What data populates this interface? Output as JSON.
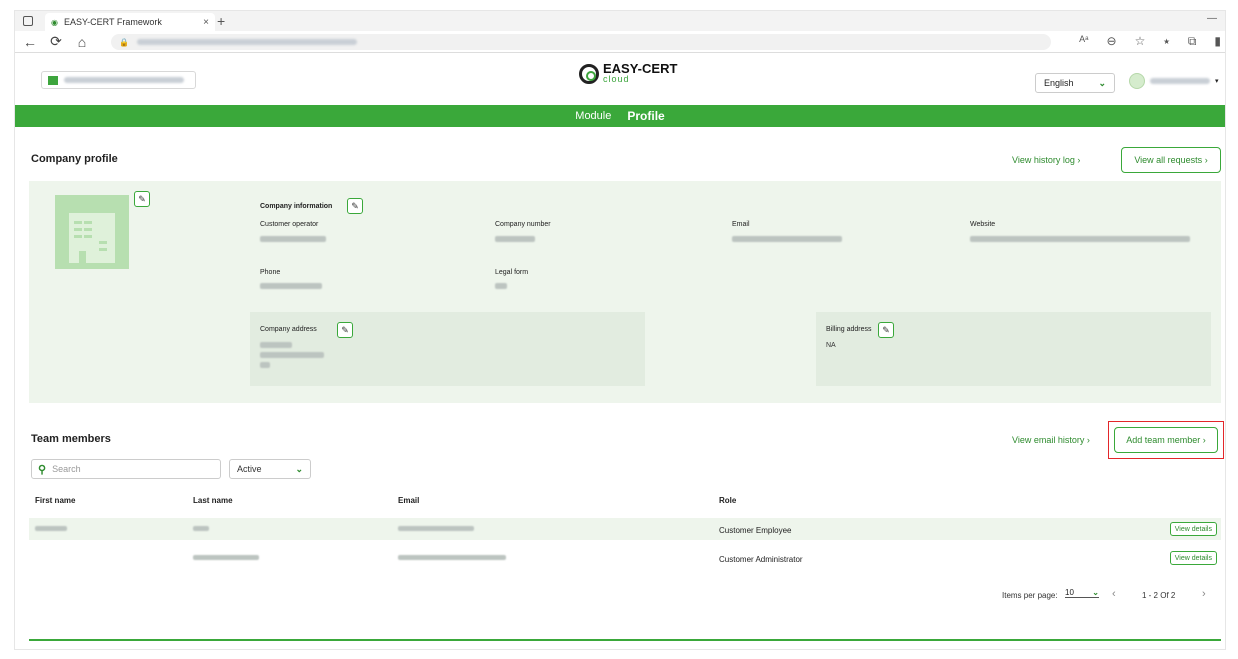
{
  "browser": {
    "tab_title": "EASY-CERT Framework",
    "close_glyph": "×",
    "new_tab_glyph": "+",
    "minimize_glyph": "—",
    "nav_glyphs": [
      "←",
      "⟳",
      "⌂",
      "🔒"
    ],
    "right_glyphs": [
      "Aᵃ",
      "⊖",
      "☆",
      "⭑",
      "⧉",
      "▮"
    ]
  },
  "header": {
    "logo_main": "EASY-CERT",
    "logo_sub": "cloud",
    "language": "English"
  },
  "nav": {
    "module": "Module",
    "profile": "Profile"
  },
  "company": {
    "title": "Company profile",
    "view_history": "View history log",
    "view_requests": "View all requests",
    "info_label": "Company information",
    "customer_operator_label": "Customer operator",
    "company_number_label": "Company number",
    "email_label": "Email",
    "website_label": "Website",
    "phone_label": "Phone",
    "legal_form_label": "Legal form",
    "company_address_label": "Company address",
    "billing_address_label": "Billing address",
    "billing_address_value": "NA"
  },
  "team": {
    "title": "Team members",
    "view_email_history": "View email history",
    "add_member": "Add team member",
    "search_placeholder": "Search",
    "status_filter": "Active",
    "columns": {
      "first_name": "First name",
      "last_name": "Last name",
      "email": "Email",
      "role": "Role"
    },
    "rows": [
      {
        "role": "Customer Employee",
        "action": "View details"
      },
      {
        "role": "Customer Administrator",
        "action": "View details"
      }
    ],
    "items_per_page_label": "Items per page:",
    "items_per_page": "10",
    "range": "1 - 2 Of 2"
  },
  "colors": {
    "brand_green": "#3aa83a",
    "highlight_red": "#e3262a"
  },
  "icons": {
    "edit": "pencil-icon",
    "search": "search-icon",
    "chevron": "chevron-down-icon"
  }
}
